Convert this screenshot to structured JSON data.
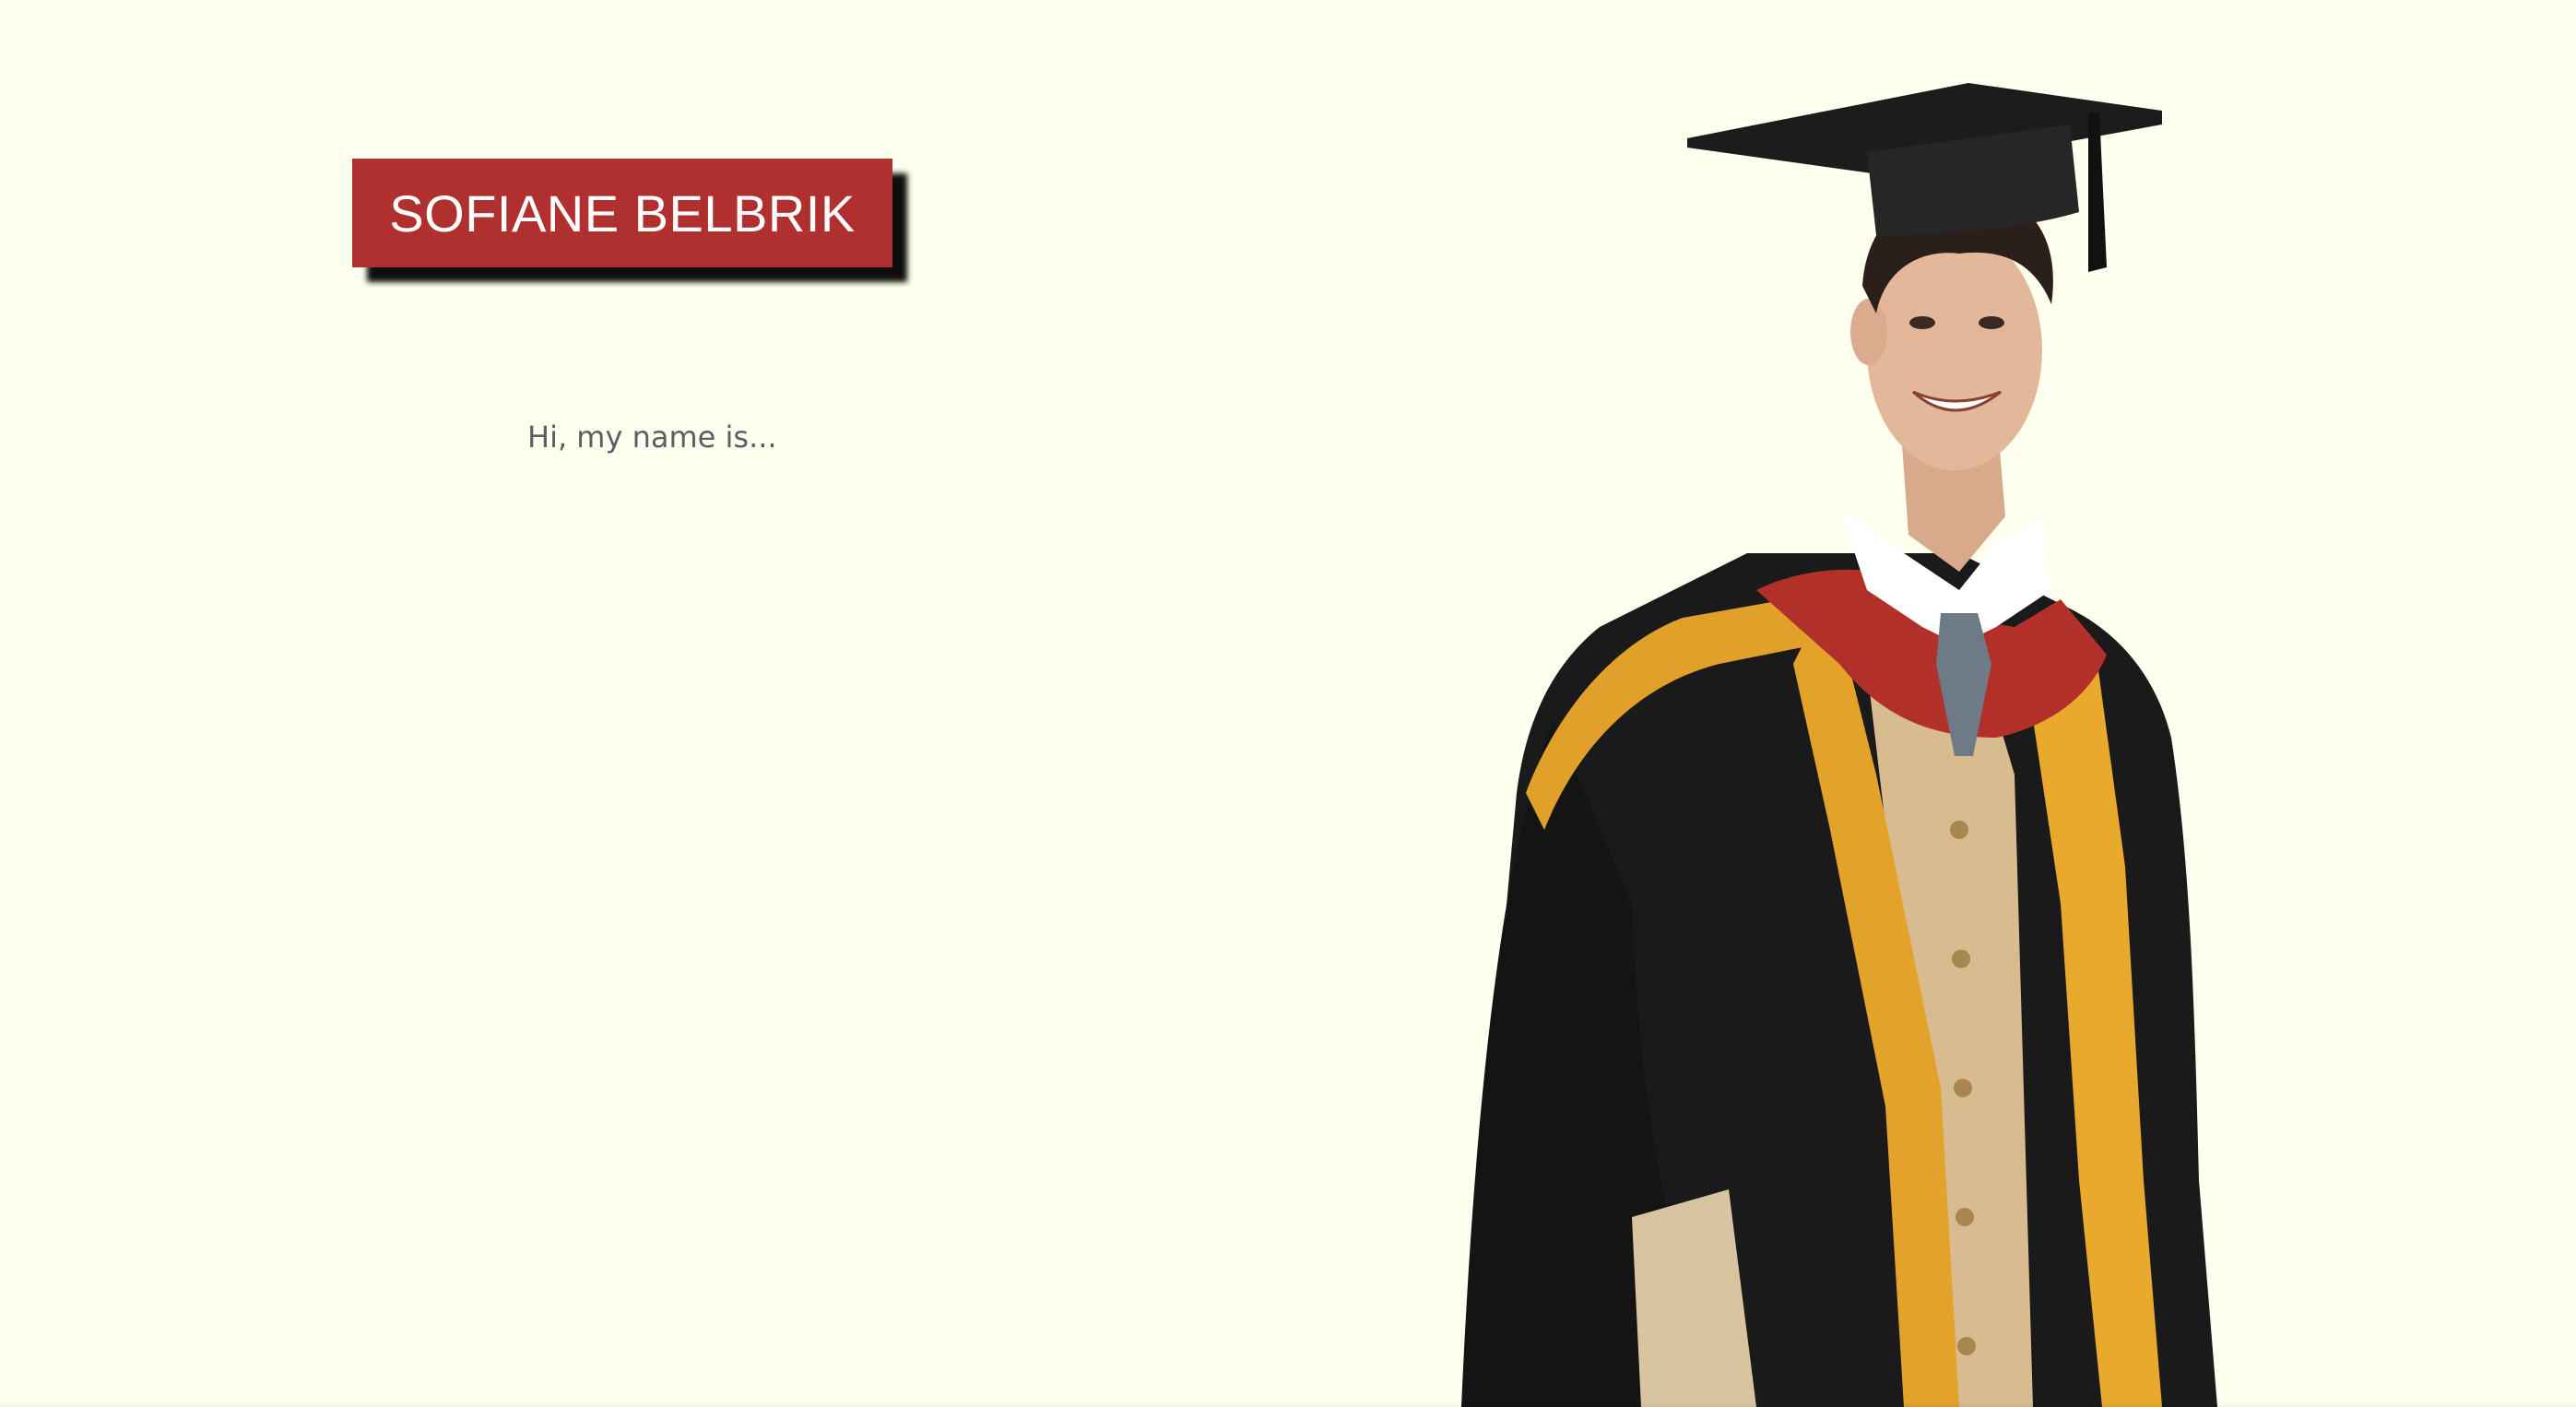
{
  "hero": {
    "name": "SOFIANE BELBRIK",
    "greeting": "Hi, my name is..."
  },
  "portrait": {
    "icon": "graduate-portrait-icon"
  },
  "colors": {
    "background": "#FFFFF0",
    "banner": "#B0302F",
    "banner_text": "#FFFFFF",
    "greeting_text": "#5A5F66",
    "gown": "#1A1A1A",
    "hood_gold": "#E3A32B",
    "hood_red": "#B2302A",
    "waistcoat": "#D8BC8F",
    "skin": "#E3B89A"
  }
}
